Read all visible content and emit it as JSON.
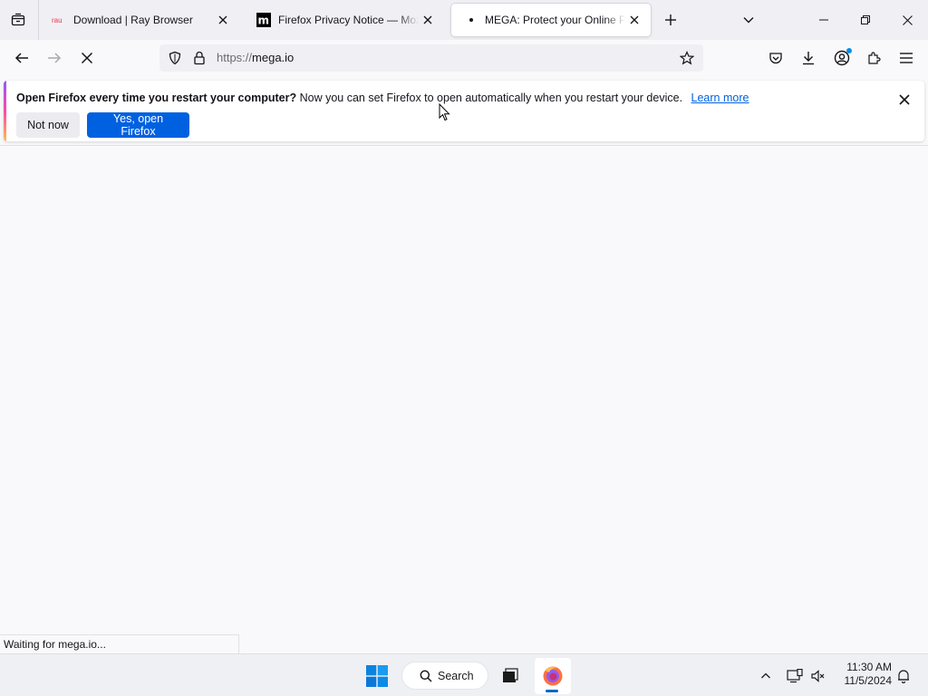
{
  "tabs": [
    {
      "title": "Download | Ray Browser",
      "favicon": "ray-favicon",
      "active": false
    },
    {
      "title": "Firefox Privacy Notice — Mozilla",
      "favicon": "mozilla-m-favicon",
      "active": false
    },
    {
      "title": "MEGA: Protect your Online Privacy",
      "favicon": "loading-dot",
      "active": true
    }
  ],
  "urlbar": {
    "scheme": "https://",
    "host": "mega.io"
  },
  "notification": {
    "bold": "Open Firefox every time you restart your computer?",
    "text": "Now you can set Firefox to open automatically when you restart your device.",
    "link": "Learn more",
    "secondary_button": "Not now",
    "primary_button": "Yes, open Firefox"
  },
  "status": "Waiting for mega.io...",
  "taskbar": {
    "search_label": "Search",
    "time": "11:30 AM",
    "date": "11/5/2024"
  },
  "icons": {
    "tab_list": "tab-list-icon",
    "back": "back-arrow-icon",
    "forward": "forward-arrow-icon",
    "stop": "stop-loading-icon",
    "tracking": "shield-icon",
    "lock": "lock-icon",
    "bookmark": "star-icon",
    "pocket": "pocket-icon",
    "downloads": "download-icon",
    "account": "account-icon",
    "extensions": "puzzle-icon",
    "menu": "hamburger-menu-icon"
  },
  "colors": {
    "accent": "#0061e0",
    "link": "#0061e0",
    "account_badge": "#0090ed"
  }
}
